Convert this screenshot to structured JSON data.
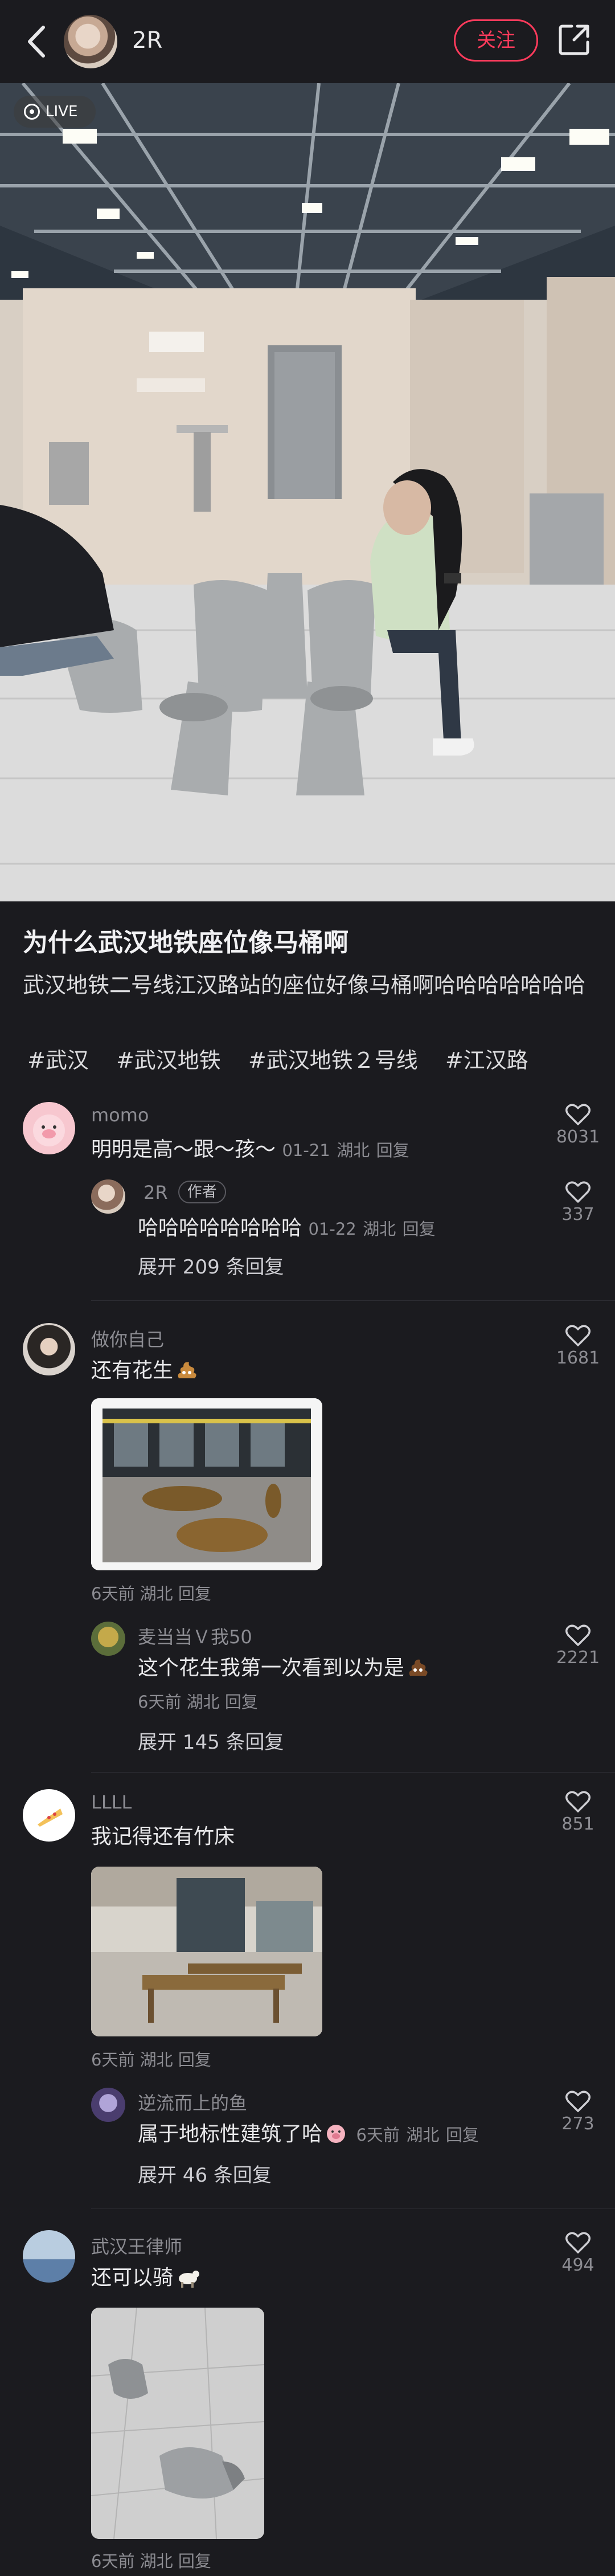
{
  "header": {
    "author_name": "2R",
    "follow_label": "关注"
  },
  "hero": {
    "live_label": "LIVE"
  },
  "post": {
    "title": "为什么武汉地铁座位像马桶啊",
    "body": "武汉地铁二号线江汉路站的座位好像马桶啊哈哈哈哈哈哈哈",
    "tags": [
      "#武汉",
      "#武汉地铁",
      "#武汉地铁２号线",
      "#江汉路"
    ]
  },
  "comments": [
    {
      "user": "momo",
      "text": "明明是高～跟～孩～",
      "time": "01-21",
      "location": "湖北",
      "reply_label": "回复",
      "likes": "8031",
      "replies": [
        {
          "user": "2R",
          "badge": "作者",
          "text": "哈哈哈哈哈哈哈哈",
          "time": "01-22",
          "location": "湖北",
          "reply_label": "回复",
          "likes": "337"
        }
      ],
      "expand_label": "展开 209 条回复"
    },
    {
      "user": "做你自己",
      "text": "还有花生",
      "time": "6天前",
      "location": "湖北",
      "reply_label": "回复",
      "likes": "1681",
      "replies": [
        {
          "user": "麦当当Ｖ我50",
          "text": "这个花生我第一次看到以为是",
          "time": "6天前",
          "location": "湖北",
          "reply_label": "回复",
          "likes": "2221"
        }
      ],
      "expand_label": "展开 145 条回复"
    },
    {
      "user": "LLLL",
      "text": "我记得还有竹床",
      "time": "6天前",
      "location": "湖北",
      "reply_label": "回复",
      "likes": "851",
      "replies": [
        {
          "user": "逆流而上的鱼",
          "text": "属于地标性建筑了哈",
          "time": "6天前",
          "location": "湖北",
          "reply_label": "回复",
          "likes": "273"
        }
      ],
      "expand_label": "展开 46 条回复"
    },
    {
      "user": "武汉王律师",
      "text": "还可以骑",
      "time": "6天前",
      "location": "湖北",
      "reply_label": "回复",
      "likes": "494"
    }
  ],
  "colors": {
    "background": "#1b1b1f",
    "accent": "#ff3b5c",
    "muted_text": "#8c8c92"
  },
  "icons": [
    "back-arrow-icon",
    "share-icon",
    "live-icon",
    "heart-icon"
  ]
}
